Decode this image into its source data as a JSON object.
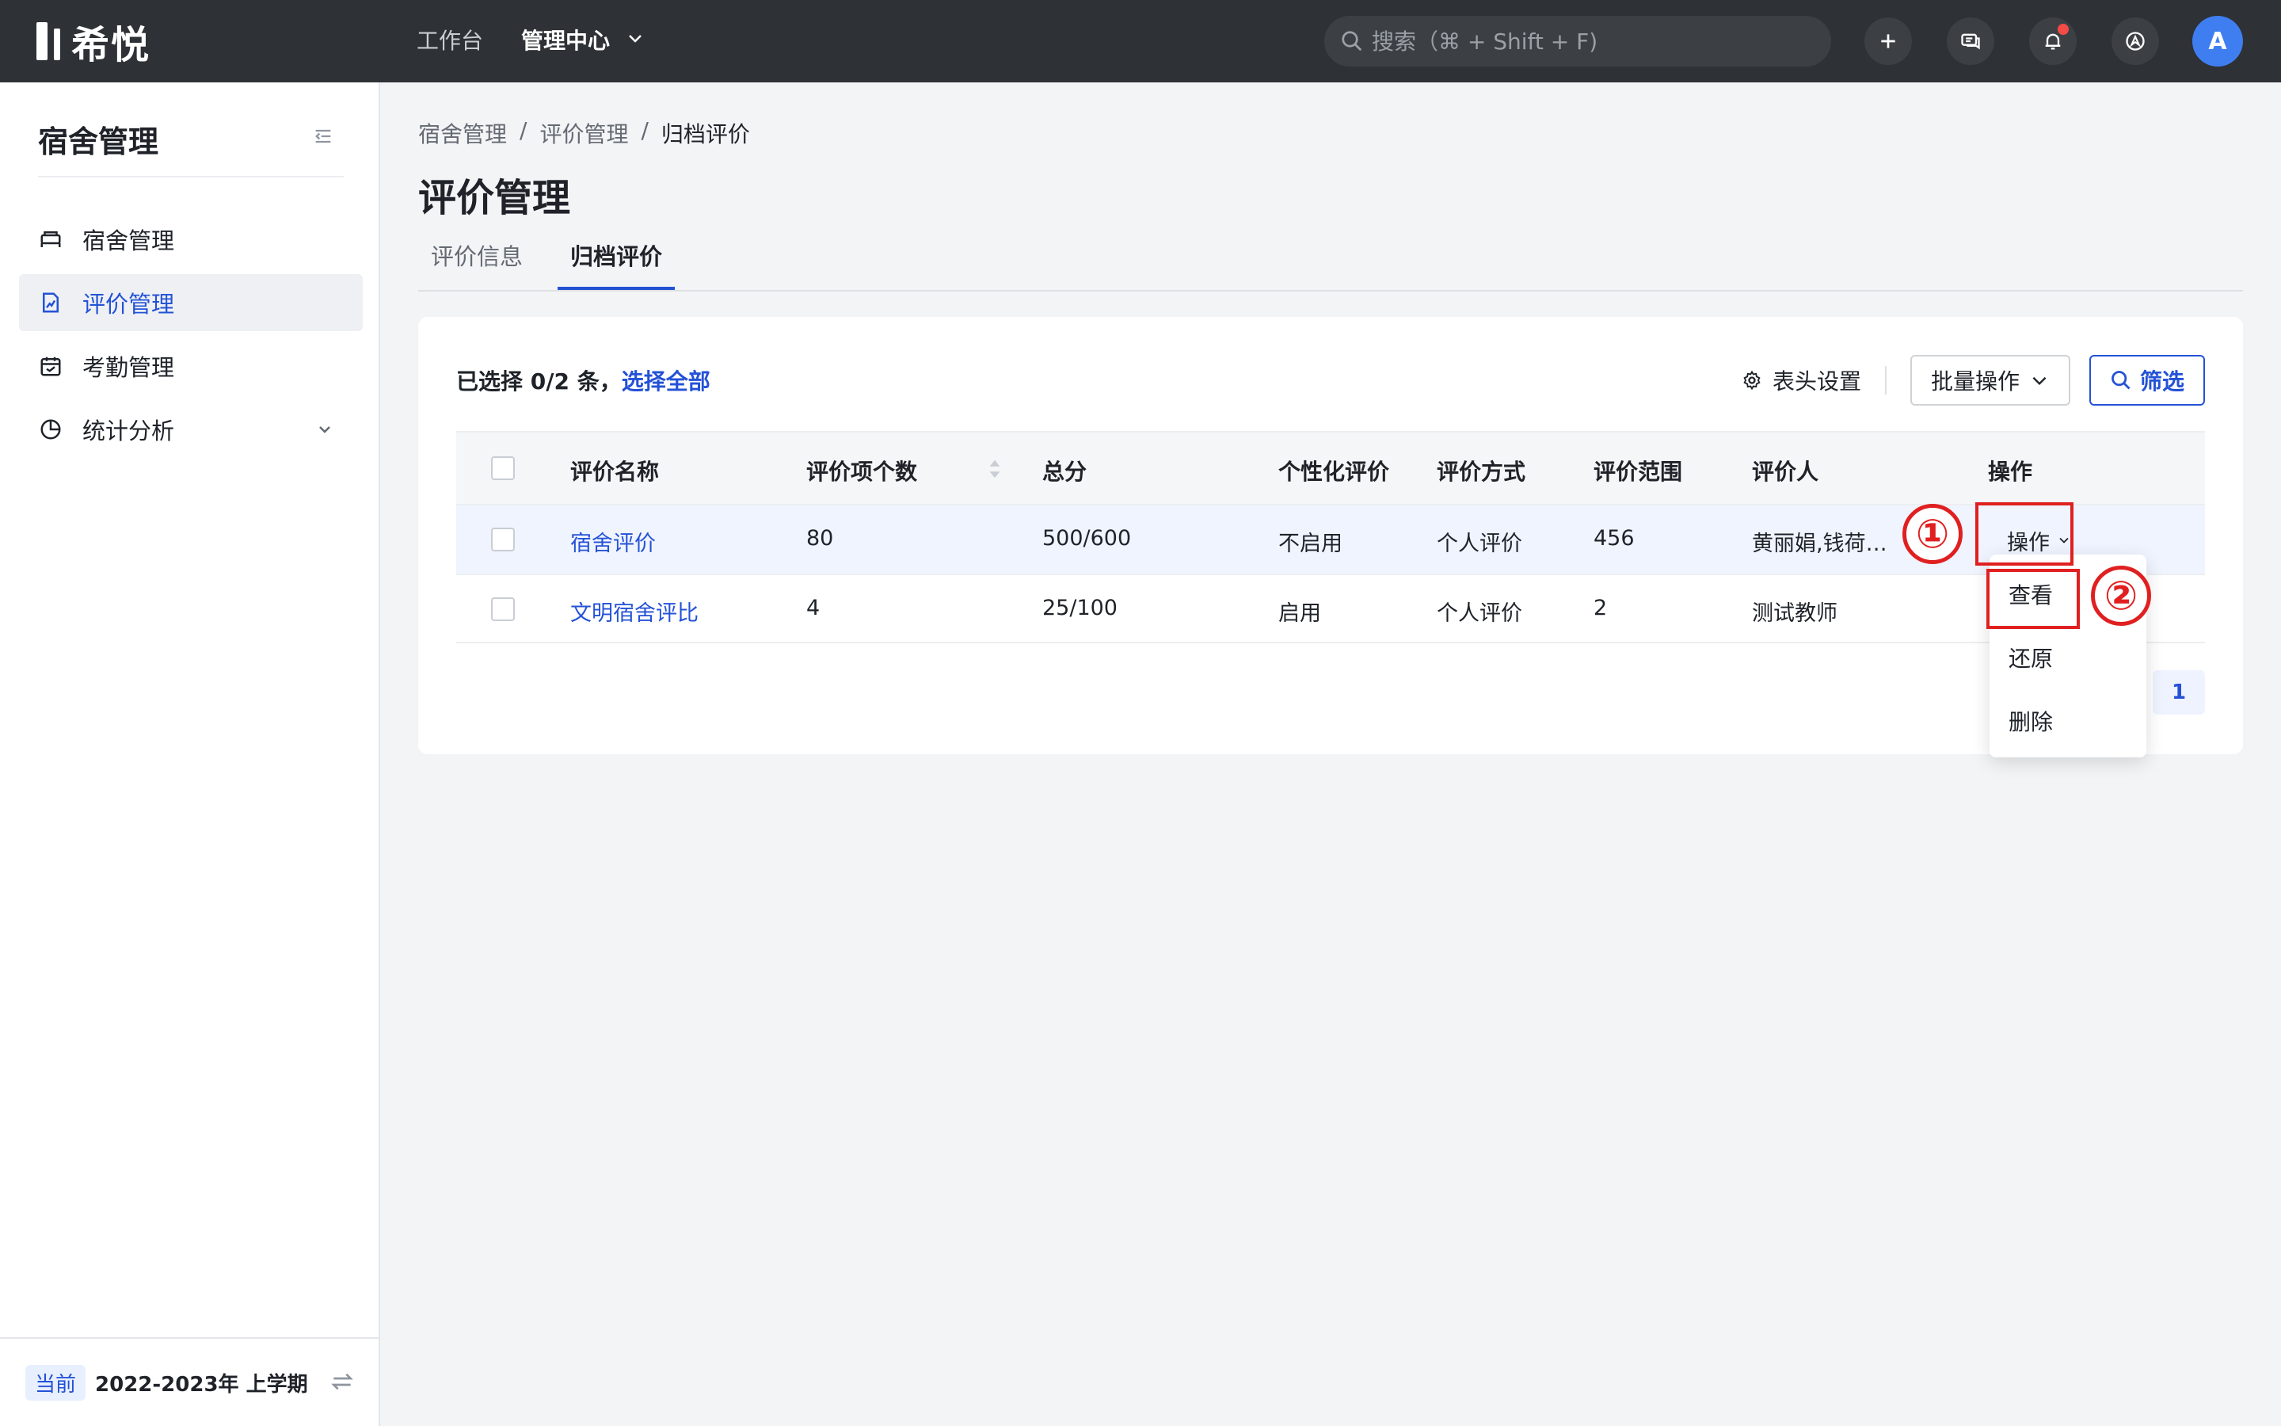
{
  "app": {
    "logo": "希悦"
  },
  "topnav": {
    "workbench": "工作台",
    "admin_center": "管理中心"
  },
  "search": {
    "placeholder": "搜索（⌘ + Shift + F)"
  },
  "user": {
    "avatar_initial": "A"
  },
  "sidebar": {
    "title": "宿舍管理",
    "items": [
      {
        "label": "宿舍管理",
        "icon": "bed-icon",
        "active": false
      },
      {
        "label": "评价管理",
        "icon": "evaluation-icon",
        "active": true
      },
      {
        "label": "考勤管理",
        "icon": "calendar-icon",
        "active": false
      },
      {
        "label": "统计分析",
        "icon": "pie-chart-icon",
        "active": false,
        "expandable": true
      }
    ],
    "footer": {
      "badge": "当前",
      "term": "2022-2023年 上学期"
    }
  },
  "breadcrumb": [
    "宿舍管理",
    "/",
    "评价管理",
    "/",
    "归档评价"
  ],
  "page_title": "评价管理",
  "tabs": [
    {
      "label": "评价信息",
      "active": false
    },
    {
      "label": "归档评价",
      "active": true
    }
  ],
  "toolbar": {
    "selection_prefix": "已选择 0/2 条，",
    "select_all": "选择全部",
    "header_settings": "表头设置",
    "batch_ops": "批量操作",
    "filter": "筛选"
  },
  "table": {
    "columns": [
      "评价名称",
      "评价项个数",
      "总分",
      "个性化评价",
      "评价方式",
      "评价范围",
      "评价人",
      "操作"
    ],
    "rows": [
      {
        "name": "宿舍评价",
        "items": "80",
        "score": "500/600",
        "personalized": "不启用",
        "method": "个人评价",
        "scope": "456",
        "evaluator": "黄丽娟,钱荷…",
        "action": "操作"
      },
      {
        "name": "文明宿舍评比",
        "items": "4",
        "score": "25/100",
        "personalized": "启用",
        "method": "个人评价",
        "scope": "2",
        "evaluator": "测试教师",
        "action": ""
      }
    ]
  },
  "dropdown": {
    "items": [
      "查看",
      "还原",
      "删除"
    ]
  },
  "annotations": {
    "one": "①",
    "two": "②"
  },
  "pagination": {
    "current": "1"
  },
  "colors": {
    "accent": "#2452d6",
    "topbar": "#2e3135",
    "annotation": "#e02020"
  }
}
